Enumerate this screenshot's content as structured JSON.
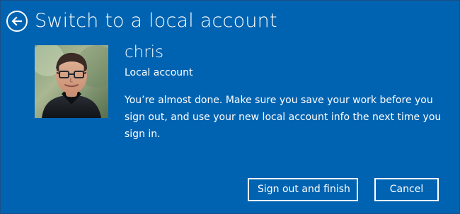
{
  "window": {
    "title": "Switch to a local account"
  },
  "icons": {
    "back": "back-arrow-icon"
  },
  "account": {
    "username": "chris",
    "type": "Local account",
    "message": "You’re almost done. Make sure you save your work before you sign out, and use your new local account info the next time you sign in."
  },
  "actions": {
    "primary_label": "Sign out and finish",
    "cancel_label": "Cancel"
  },
  "colors": {
    "background": "#0063b1",
    "text": "#ffffff",
    "border": "#ffffff"
  }
}
